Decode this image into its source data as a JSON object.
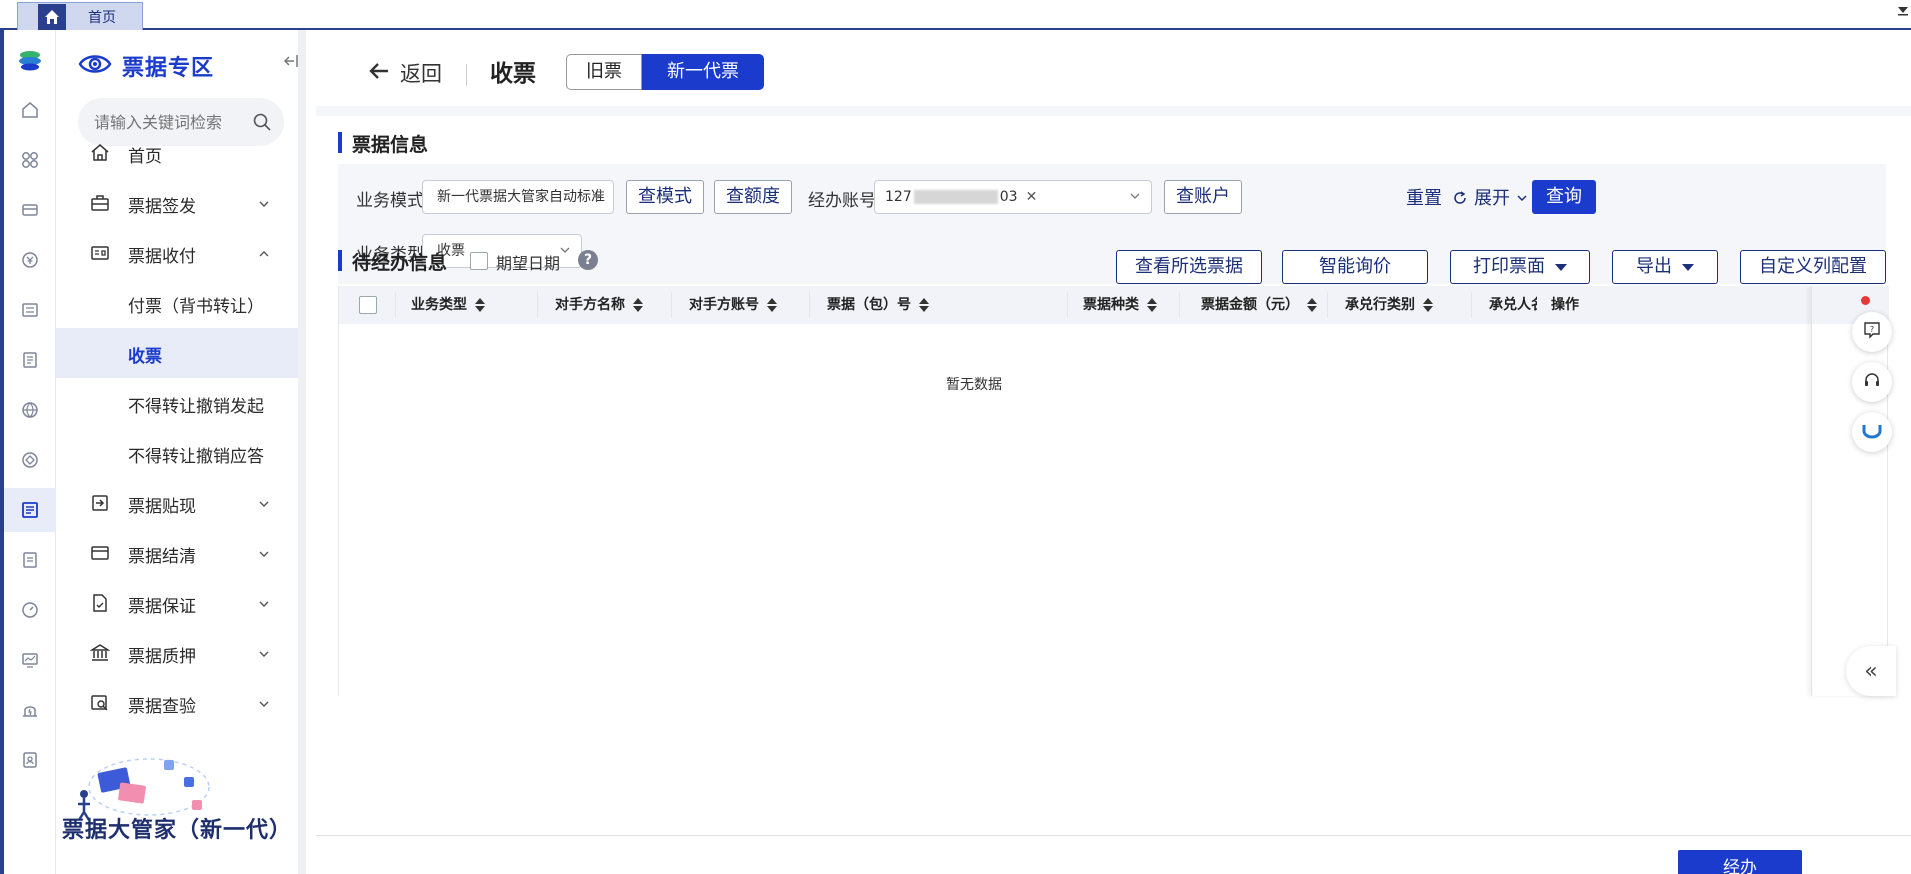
{
  "top_tab": {
    "home_label": "首页"
  },
  "sidebar": {
    "title": "票据专区",
    "search_placeholder": "请输入关键词检索",
    "items": [
      {
        "label": "首页",
        "icon": "home-icon"
      },
      {
        "label": "票据签发",
        "icon": "briefcase-icon"
      },
      {
        "label": "票据收付",
        "icon": "card-icon"
      },
      {
        "label": "票据贴现",
        "icon": "enter-icon"
      },
      {
        "label": "票据结清",
        "icon": "window-icon"
      },
      {
        "label": "票据保证",
        "icon": "document-check-icon"
      },
      {
        "label": "票据质押",
        "icon": "bank-icon"
      },
      {
        "label": "票据查验",
        "icon": "search-document-icon"
      }
    ],
    "sub_items": [
      {
        "label": "付票（背书转让）"
      },
      {
        "label": "收票"
      },
      {
        "label": "不得转让撤销发起"
      },
      {
        "label": "不得转让撤销应答"
      }
    ],
    "footer": "票据大管家（新一代）"
  },
  "header": {
    "back_label": "返回",
    "title": "收票",
    "seg_old": "旧票",
    "seg_new": "新一代票"
  },
  "bill_info": {
    "section_title": "票据信息",
    "biz_mode_label": "业务模式",
    "biz_mode_value": "新一代票据大管家自动标准",
    "btn_check_mode": "查模式",
    "btn_check_quota": "查额度",
    "account_label": "经办账号",
    "account_prefix": "127",
    "account_suffix": "03",
    "btn_check_account": "查账户",
    "reset_label": "重置",
    "expand_label": "展开",
    "query_label": "查询",
    "biz_type_label": "业务类型",
    "biz_type_value": "收票"
  },
  "pending": {
    "section_title": "待经办信息",
    "expected_date_label": "期望日期",
    "help": "?",
    "btn_view_selected": "查看所选票据",
    "btn_smart_price": "智能询价",
    "btn_print": "打印票面",
    "btn_export": "导出",
    "btn_custom_cols": "自定义列配置"
  },
  "table": {
    "columns": [
      "业务类型",
      "对手方名称",
      "对手方账号",
      "票据（包）号",
      "票据种类",
      "票据金额（元）",
      "承兑行类别",
      "承兑人名",
      "操作"
    ],
    "empty_text": "暂无数据"
  },
  "footer_action": {
    "label": "经办"
  },
  "colors": {
    "primary": "#1a3bcb",
    "frame": "#2b3f8f",
    "badge": "#e53935"
  }
}
